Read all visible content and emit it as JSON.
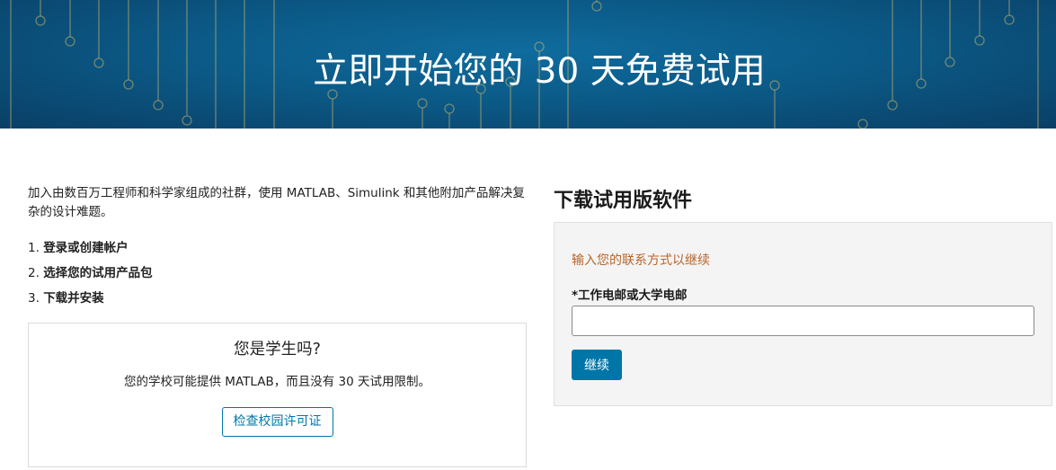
{
  "hero": {
    "title": "立即开始您的 30 天免费试用"
  },
  "intro": {
    "text": "加入由数百万工程师和科学家组成的社群，使用 MATLAB、Simulink 和其他附加产品解决复杂的设计难题。"
  },
  "steps": [
    {
      "num": "1.",
      "text": "登录或创建帐户"
    },
    {
      "num": "2.",
      "text": "选择您的试用产品包"
    },
    {
      "num": "3.",
      "text": "下载并安装"
    }
  ],
  "student": {
    "title": "您是学生吗?",
    "description": "您的学校可能提供 MATLAB，而且没有 30 天试用限制。",
    "button_label": "检查校园许可证"
  },
  "download": {
    "title": "下载试用版软件",
    "prompt": "输入您的联系方式以继续",
    "email_label": "*工作电邮或大学电邮",
    "email_value": "",
    "continue_label": "继续"
  },
  "colors": {
    "hero_bg": "#0b5a87",
    "accent_blue": "#0076a8",
    "prompt_orange": "#b7652a",
    "panel_bg": "#f4f4f4"
  }
}
